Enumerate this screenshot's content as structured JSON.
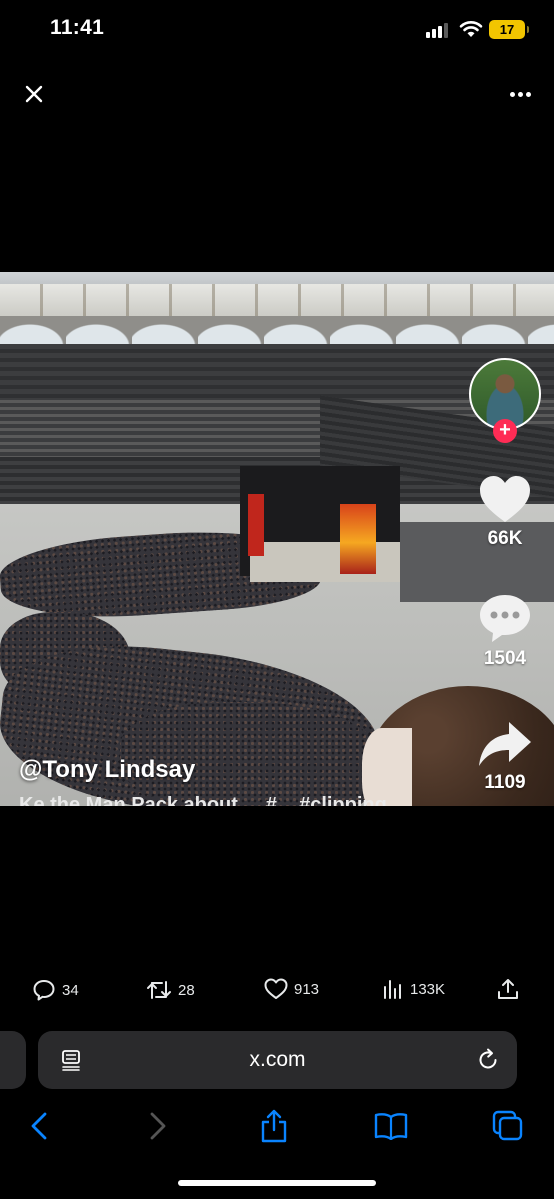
{
  "status_bar": {
    "time": "11:41",
    "battery": "17",
    "accent_battery": "#f2c500"
  },
  "top_bar": {
    "close_icon": "close-icon",
    "more_icon": "more-horizontal-icon"
  },
  "video": {
    "username": "@Tony Lindsay",
    "caption": "Ke the Man Pack about ... #... #clipping",
    "actions": {
      "likes": "66K",
      "comments": "1504",
      "shares": "1109"
    },
    "follow_color": "#fe2c55"
  },
  "tweet_actions": {
    "replies": "34",
    "reposts": "28",
    "likes": "913",
    "views": "133K"
  },
  "browser": {
    "url": "x.com",
    "reader_icon": "page-menu-icon",
    "reload_icon": "reload-icon"
  },
  "toolbar": {
    "items": [
      "back-icon",
      "forward-icon",
      "share-icon",
      "bookmarks-icon",
      "tabs-icon"
    ],
    "accent": "#0a84ff"
  }
}
